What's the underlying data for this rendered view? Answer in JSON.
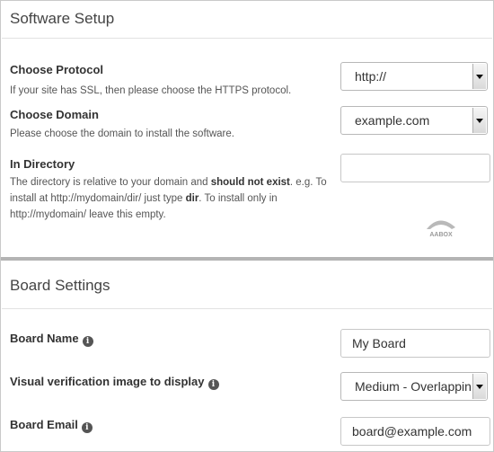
{
  "software_setup": {
    "title": "Software Setup",
    "protocol": {
      "label": "Choose Protocol",
      "description": "If your site has SSL, then please choose the HTTPS protocol.",
      "value": "http://"
    },
    "domain": {
      "label": "Choose Domain",
      "description": "Please choose the domain to install the software.",
      "value": "example.com"
    },
    "directory": {
      "label": "In Directory",
      "desc_part1": "The directory is relative to your domain and ",
      "desc_bold1": "should not exist",
      "desc_part2": ". e.g. To install at http://mydomain/dir/ just type ",
      "desc_bold2": "dir",
      "desc_part3": ". To install only in http://mydomain/ leave this empty.",
      "value": ""
    },
    "logo_text": "AABOX"
  },
  "board_settings": {
    "title": "Board Settings",
    "board_name": {
      "label": "Board Name",
      "value": "My Board"
    },
    "visual_verification": {
      "label": "Visual verification image to display",
      "value": "Medium - Overlapping"
    },
    "board_email": {
      "label": "Board Email",
      "value": "board@example.com"
    }
  },
  "icons": {
    "info": "info-icon"
  }
}
